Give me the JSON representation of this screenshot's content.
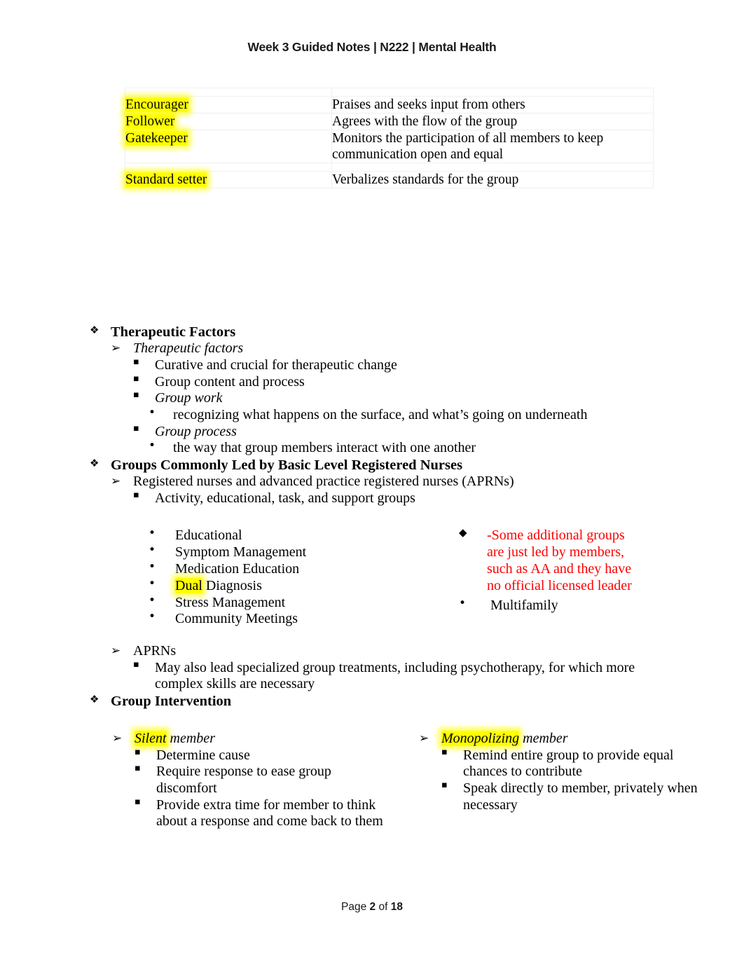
{
  "header": {
    "title": "Week 3 Guided Notes | N222 | Mental Health"
  },
  "role_table": {
    "rows": [
      {
        "term": "Encourager",
        "desc": "Praises and seeks input from others"
      },
      {
        "term": "Follower",
        "desc": "Agrees with the flow of the group"
      },
      {
        "term": "Gatekeeper",
        "desc": "Monitors the participation of all members to keep communication open and equal"
      },
      {
        "term": "Standard setter",
        "desc": "Verbalizes standards for the group"
      }
    ]
  },
  "bullets": {
    "diamond": "❖",
    "arrow": "➢",
    "square": "▪",
    "dot": "•",
    "solid_diamond": "◆"
  },
  "outline": {
    "therapeutic_factors_heading": "Therapeutic Factors",
    "therapeutic_factors_sub": "Therapeutic factors",
    "curative": "Curative and crucial for therapeutic change",
    "group_content": "Group content and process",
    "group_work": "Group work",
    "group_work_detail": "recognizing what happens on the surface, and what’s going on underneath",
    "group_process": "Group process",
    "group_process_detail": "the way that group members interact with one another",
    "groups_led_heading": "Groups Commonly Led by Basic Level Registered Nurses",
    "registered_nurses": "Registered nurses and advanced practice registered nurses (APRNs)",
    "activity_groups": "Activity, educational, task, and support groups"
  },
  "groups_band": {
    "left_items": [
      "Educational",
      "Symptom Management",
      "Medication Education",
      "Dual Diagnosis",
      "Stress Management",
      "Community Meetings"
    ],
    "dual_highlight": "Dual",
    "dual_rest": " Diagnosis",
    "red_note": "-Some additional groups are just led by members, such as AA and they have no official licensed leader",
    "red_note_lines": [
      "-Some additional groups",
      "are just led by members,",
      "such as AA and they have",
      "no official licensed leader"
    ],
    "multifamily": "Multifamily"
  },
  "aprn_block": {
    "aprns": "APRNs",
    "aprns_detail": "May also lead specialized group treatments, including psychotherapy, for which more complex skills are necessary",
    "group_intervention_heading": "Group Intervention"
  },
  "intervention": {
    "left": {
      "title_highlight": "Silent",
      "title_rest": " member",
      "items": [
        "Determine cause",
        "Require response to ease group discomfort",
        "Provide extra time for member to think about a response and come back to them"
      ]
    },
    "right": {
      "title_highlight": "Monopolizing",
      "title_rest": " member",
      "items": [
        "Remind entire group to provide equal chances to contribute",
        "Speak directly to member, privately when necessary"
      ]
    }
  },
  "footer": {
    "prefix": "Page ",
    "current": "2",
    "middle": " of ",
    "total": "18"
  },
  "colors": {
    "red_accent": "#ff0000",
    "highlight": "#ffff00",
    "text": "#000000"
  }
}
